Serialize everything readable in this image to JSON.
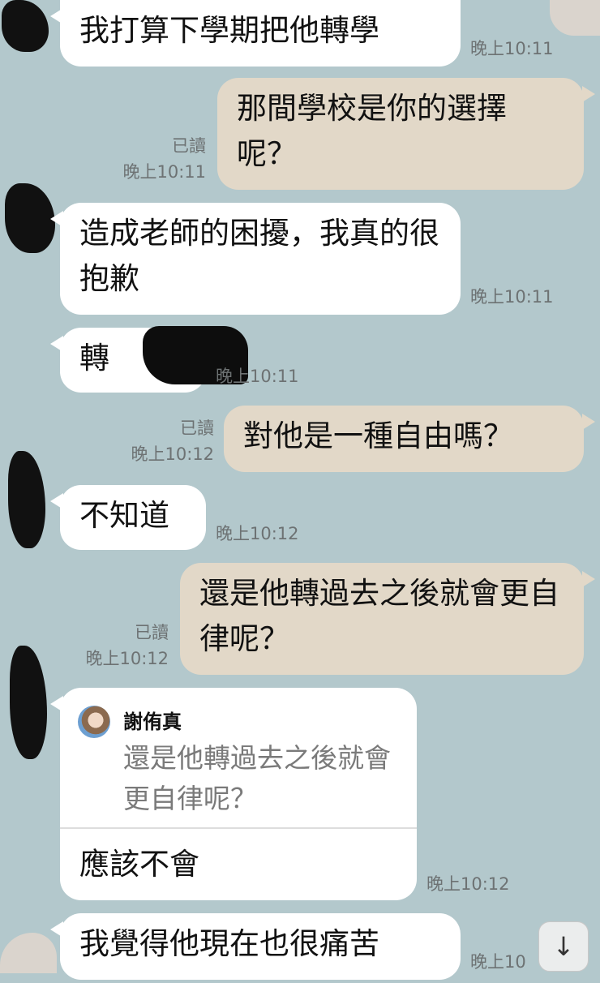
{
  "messages": [
    {
      "text": "我打算下學期把他轉學",
      "time": "晚上10:11"
    },
    {
      "text": "那間學校是你的選擇呢？",
      "read": "已讀",
      "time": "晚上10:11"
    },
    {
      "text": "造成老師的困擾，我真的很抱歉",
      "time": "晚上10:11"
    },
    {
      "text": "轉",
      "time": "晚上10:11"
    },
    {
      "text": "對他是一種自由嗎？",
      "read": "已讀",
      "time": "晚上10:12"
    },
    {
      "text": "不知道",
      "time": "晚上10:12"
    },
    {
      "text": "還是他轉過去之後就會更自律呢？",
      "read": "已讀",
      "time": "晚上10:12"
    },
    {
      "text": "應該不會",
      "time": "晚上10:12",
      "quote": {
        "name": "謝侑真",
        "text": "還是他轉過去之後就會更自律呢？"
      }
    },
    {
      "text": "我覺得他現在也很痛苦",
      "time": "晚上10"
    }
  ],
  "scroll_icon": "arrow-down-icon",
  "scroll_glyph": "↓",
  "colors": {
    "background": "#b3c8cc",
    "incoming_bubble": "#ffffff",
    "outgoing_bubble": "#e2d8c8",
    "meta_text": "#6d7273"
  }
}
